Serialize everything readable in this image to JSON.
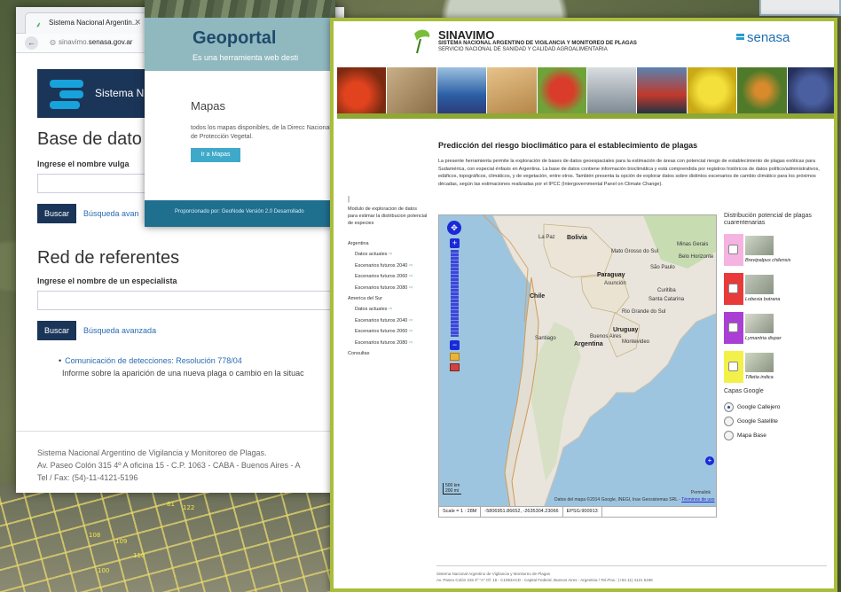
{
  "browser": {
    "tab_title": "Sistema Nacional Argentin...",
    "url_host": "sinavimo.",
    "url_domain": "senasa.gov.ar"
  },
  "base_page": {
    "banner_text": "Sistema N",
    "section1_title": "Base de dato",
    "section1_label": "Ingrese el nombre vulga",
    "search_button": "Buscar",
    "advanced_link_truncated": "Búsqueda avan",
    "section2_title": "Red de referentes",
    "section2_label": "Ingrese el nombre de un especialista",
    "advanced_link": "Búsqueda avanzada",
    "news_link": "Comunicación de detecciones: Resolución 778/04",
    "news_desc": "Informe sobre la aparición de una nueva plaga o cambio en la situac",
    "footer_line1": "Sistema Nacional Argentino de Vigilancia y Monitoreo de Plagas.",
    "footer_line2": "Av. Paseo Colón 315 4º A oficina 15 - C.P. 1063 - CABA - Buenos Aires - A",
    "footer_line3": "Tel / Fax: (54)-11-4121-5196"
  },
  "geoportal": {
    "title": "Geoportal",
    "subtitle": "Es una herramienta web desti",
    "section_title": "Mapas",
    "section_text": "todos los mapas disponibles, de la Direcc Nacional de Protección Vegetal.",
    "button": "Ir a Mapas",
    "footer": "Proporcionado por: GeoNode Versión 2.0 Desarrollado"
  },
  "prediction": {
    "brand_title": "SINAVIMO",
    "brand_sub1": "SISTEMA NACIONAL ARGENTINO DE VIGILANCIA Y MONITOREO DE PLAGAS",
    "brand_sub2": "SERVICIO NACIONAL DE SANIDAD Y CALIDAD AGROALIMENTARIA",
    "senasa_logo": "senasa",
    "title": "Predicción del riesgo bioclimático para el establecimiento de plagas",
    "description": "La presente herramienta permite la exploración de bases de datos geoespaciales para la estimación de áreas con potencial riesgo de establecimiento de plagas exóticas para Sudamérica, con especial énfasis en Argentina. La base de datos contiene información bioclimática y está comprendida por registros históricos de datos político/administrativos, edáficos, topográficos, climáticos, y de vegetación, entre otros. También presenta la opción de explorar datos sobre distintos escenarios de cambio climático para los próximos décadas, según las estimaciones realizadas por el IPCC (Intergovernmental Panel on Climate Change).",
    "menu_cursor": "|",
    "menu_intro": "Modulo de exploracion de datos para estimar la distribucion potencial de especies",
    "menu": [
      {
        "label": "Argentina",
        "sub": false
      },
      {
        "label": "Datos actuales",
        "sub": true
      },
      {
        "label": "Escenarios futuros 2040",
        "sub": true
      },
      {
        "label": "Escenarios futuros 2060",
        "sub": true
      },
      {
        "label": "Escenarios futuros 2080",
        "sub": true
      },
      {
        "label": "America del Sur",
        "sub": false
      },
      {
        "label": "Datos actuales",
        "sub": true
      },
      {
        "label": "Escenarios futuros 2040",
        "sub": true
      },
      {
        "label": "Escenarios futuros 2060",
        "sub": true
      },
      {
        "label": "Escenarios futuros 2080",
        "sub": true
      },
      {
        "label": "Consultas",
        "sub": false
      }
    ],
    "menu_arrow": "⇨",
    "map_labels": {
      "bolivia": "Bolivia",
      "paraguay": "Paraguay",
      "chile": "Chile",
      "argentina": "Argentina",
      "uruguay": "Uruguay",
      "la_paz": "La Paz",
      "mato_grosso": "Mato Grosso do Sul",
      "sao_paulo": "São Paulo",
      "asuncion": "Asunción",
      "curitiba": "Curitiba",
      "santa_catarina": "Santa Catarina",
      "rio_grande": "Rio Grande do Sul",
      "santiago": "Santiago",
      "buenos_aires": "Buenos Aires",
      "montevideo": "Montevideo",
      "belo": "Belo Horizonte",
      "minas": "Minas Gerais"
    },
    "map_permalink": "Permalink",
    "map_attribution": "Datos del mapa ©2014 Google, INEGI, Inav Geosistemas SRL -",
    "map_terms": "Términos de uso",
    "scale_text": "500 km\n200 mi",
    "status": {
      "scale": "Scale = 1 : 28M",
      "coords": "-5806951.86652, -2635304.23066",
      "epsg": "EPSG:900913"
    },
    "legend_title": "Distribución potencial de plagas cuarentenarias",
    "legend": [
      {
        "name": "Brevipalpus chilensis",
        "color": "#f4b3e0"
      },
      {
        "name": "Lobesia botrana",
        "color": "#e83a3a"
      },
      {
        "name": "Lymantria dispar",
        "color": "#a93fd4"
      },
      {
        "name": "Tilletia indica",
        "color": "#f3f04a"
      }
    ],
    "layers_title": "Capas Google",
    "layers": [
      {
        "label": "Google Callejero",
        "selected": true
      },
      {
        "label": "Google Satellite",
        "selected": false
      },
      {
        "label": "Mapa Base",
        "selected": false
      }
    ],
    "footer_line1": "Sistema Nacional Argentino de Vigilancia y Monitoreo de Plagas",
    "footer_line2": "Av. Paseo Colón 315 4º \"A\" Of. 15 - C1063ACD - Capital Federal, Buenos Aires - Argentina / Tel./Fax.: (+54 11) 4121 5196"
  },
  "aerial_plot_numbers": [
    "108",
    "109",
    "110",
    "81",
    "122",
    "100"
  ],
  "colors": {
    "accent_green": "#a9bd3c",
    "navy": "#1b3559",
    "senasa_blue": "#1c6fb2",
    "map_water": "#9ec5df"
  }
}
